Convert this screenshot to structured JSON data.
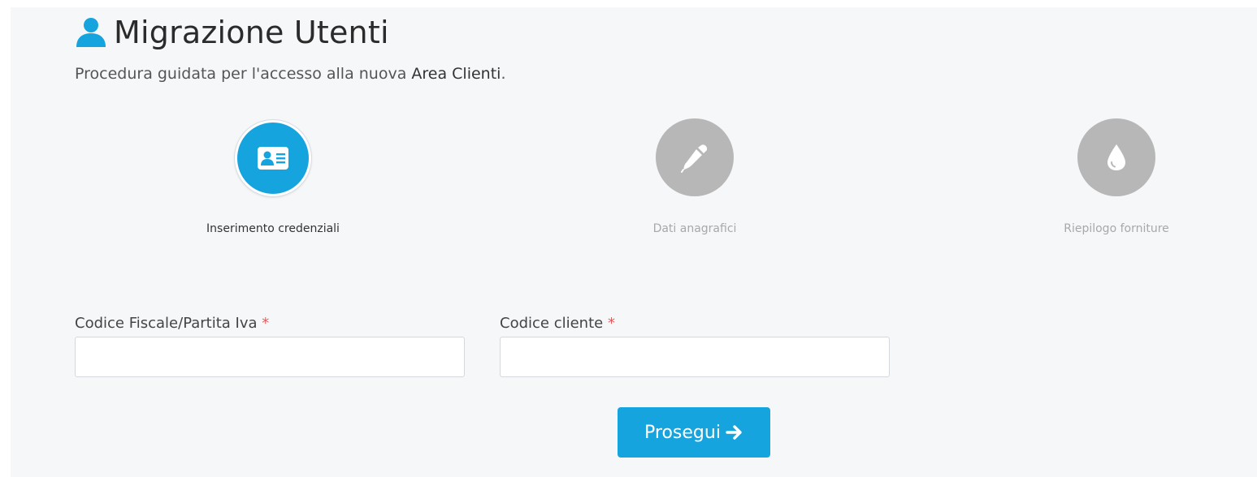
{
  "header": {
    "title": "Migrazione Utenti",
    "subtitle_prefix": "Procedura guidata per l'accesso alla nuova ",
    "subtitle_bold": "Area Clienti",
    "subtitle_suffix": "."
  },
  "steps": [
    {
      "label": "Inserimento credenziali",
      "icon": "id-card-icon",
      "active": true
    },
    {
      "label": "Dati anagrafici",
      "icon": "pen-icon",
      "active": false
    },
    {
      "label": "Riepilogo forniture",
      "icon": "water-drop-icon",
      "active": false
    }
  ],
  "form": {
    "fiscal_code": {
      "label": "Codice Fiscale/Partita Iva",
      "required_mark": "*",
      "value": ""
    },
    "customer_code": {
      "label": "Codice cliente",
      "required_mark": "*",
      "value": ""
    },
    "submit_label": "Prosegui"
  },
  "colors": {
    "accent": "#16a4df",
    "inactive_step": "#b7b7b7",
    "required": "#e05c5c",
    "background": "#f6f7f9"
  }
}
